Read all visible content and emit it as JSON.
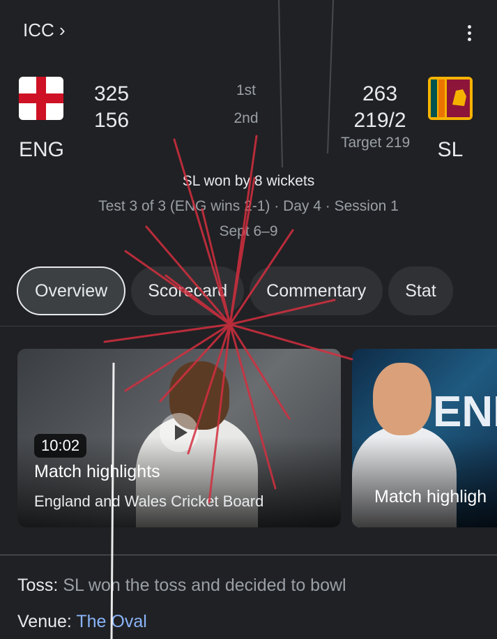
{
  "header": {
    "title": "ICC ›"
  },
  "team_left": {
    "abbr": "ENG",
    "scores": [
      "325",
      "156"
    ]
  },
  "team_right": {
    "abbr": "SL",
    "scores": [
      "263",
      "219/2"
    ],
    "target": "Target 219"
  },
  "innings": [
    "1st",
    "2nd"
  ],
  "result": {
    "main": "SL won by 8 wickets",
    "sub": "Test 3 of 3 (ENG wins 2-1) · Day 4 · Session 1",
    "date": "Sept 6–9"
  },
  "tabs": [
    "Overview",
    "Scorecard",
    "Commentary",
    "Stat"
  ],
  "videos": [
    {
      "duration": "10:02",
      "title": "Match highlights",
      "source": "England and Wales Cricket Board"
    },
    {
      "title": "Match highligh",
      "badge": "ENI"
    }
  ],
  "info": {
    "toss_label": "Toss:",
    "toss_value": "SL won the toss and decided to bowl",
    "venue_label": "Venue:",
    "venue_value": "The Oval"
  },
  "colors": {
    "background": "#202124",
    "link": "#8ab4f8",
    "firework": "#d32f3f"
  }
}
